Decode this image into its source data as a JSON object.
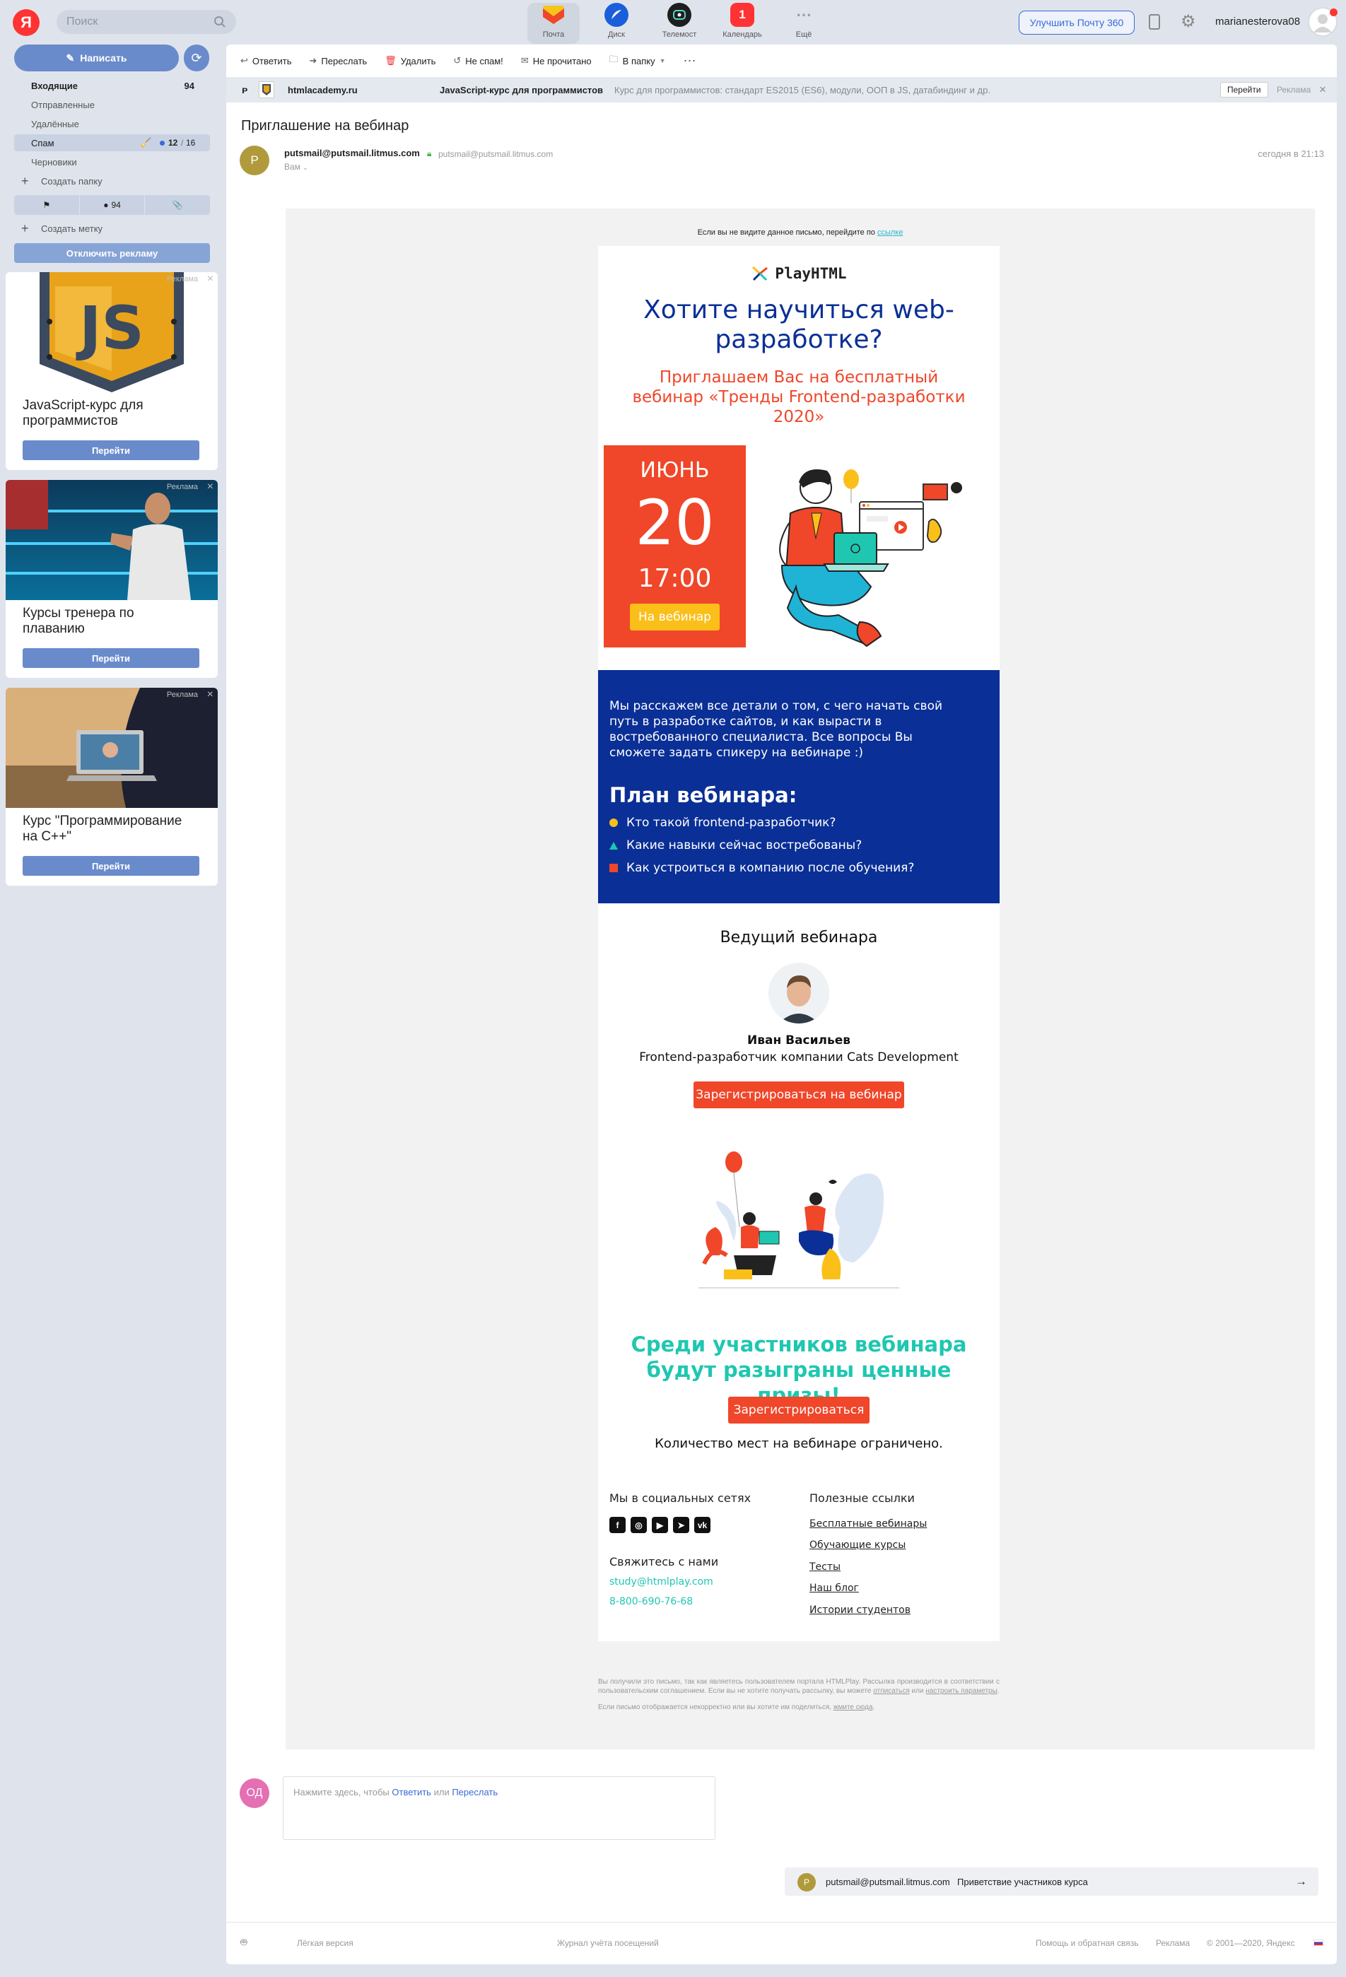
{
  "header": {
    "logo": "Я",
    "search_placeholder": "Поиск",
    "services": [
      {
        "label": "Почта",
        "icon": "mail-icon"
      },
      {
        "label": "Диск",
        "icon": "disk-icon"
      },
      {
        "label": "Телемост",
        "icon": "telemost-icon"
      },
      {
        "label": "Календарь",
        "icon": "calendar-icon",
        "badge": "1"
      },
      {
        "label": "Ещё",
        "icon": "more-icon"
      }
    ],
    "upgrade_button": "Улучшить Почту 360",
    "username": "marianesterova08"
  },
  "sidebar": {
    "compose": "Написать",
    "folders": [
      {
        "label": "Входящие",
        "count": "94"
      },
      {
        "label": "Отправленные",
        "count": ""
      },
      {
        "label": "Удалённые",
        "count": ""
      },
      {
        "label": "Спам",
        "count": "12",
        "total": "16"
      },
      {
        "label": "Черновики",
        "count": ""
      }
    ],
    "create_folder": "Создать папку",
    "tag_unread_count": "94",
    "create_label": "Создать метку",
    "disable_ads": "Отключить рекламу",
    "ad_label": "Реклама",
    "ads": [
      {
        "title": "JavaScript-курс для программистов",
        "button": "Перейти"
      },
      {
        "title": "Курсы тренера по плаванию",
        "button": "Перейти"
      },
      {
        "title": "Курс \"Программирование на С++\"",
        "button": "Перейти"
      }
    ]
  },
  "toolbar": {
    "reply": "Ответить",
    "forward": "Переслать",
    "delete": "Удалить",
    "not_spam": "Не спам!",
    "unread": "Не прочитано",
    "to_folder": "В папку"
  },
  "ad_strip": {
    "site": "htmlacademy.ru",
    "title": "JavaScript-курс для программистов",
    "text": "Курс для программистов: стандарт ES2015 (ES6), модули, ООП в JS, датабиндинг и др.",
    "button": "Перейти",
    "label": "Реклама"
  },
  "message": {
    "subject": "Приглашение на вебинар",
    "avatar_letter": "P",
    "from_name": "putsmail@putsmail.litmus.com",
    "from_address": "putsmail@putsmail.litmus.com",
    "to": "Вам",
    "date": "сегодня в 21:13"
  },
  "email": {
    "view_online_prefix": "Если вы не видите данное письмо, перейдите по",
    "view_online_link": "ссылке",
    "brand": "PlayHTML",
    "hero_title": "Хотите научиться web-разработке?",
    "hero_subtitle": "Приглашаем Вас на бесплатный вебинар «Тренды Frontend-разработки 2020»",
    "month": "ИЮНЬ",
    "day": "20",
    "time": "17:00",
    "webinar_button": "На вебинар",
    "intro": "Мы расскажем все детали о том, с чего начать свой путь в разработке сайтов, и как вырасти в востребованного специалиста. Все вопросы Вы сможете задать спикеру на вебинаре :)",
    "plan_title": "План вебинара:",
    "plan": [
      {
        "text": "Кто такой frontend-разработчик?",
        "marker": "circle",
        "color": "#fbbf1a"
      },
      {
        "text": "Какие навыки сейчас востребованы?",
        "marker": "triangle",
        "color": "#1fc7b1"
      },
      {
        "text": "Как устроиться в компанию после обучения?",
        "marker": "square",
        "color": "#f04629"
      }
    ],
    "host_title": "Ведущий вебинара",
    "host_name": "Иван Васильев",
    "host_role": "Frontend-разработчик компании Cats Development",
    "register_button": "Зарегистрироваться на вебинар",
    "prize_text": "Среди участников вебинара будут разыграны ценные призы!",
    "register_short": "Зарегистрироваться",
    "limited": "Количество мест на вебинаре ограничено.",
    "social_title": "Мы в социальных сетях",
    "contact_title": "Свяжитесь с нами",
    "email_contact": "study@htmlplay.com",
    "phone": "8-800-690-76-68",
    "useful_title": "Полезные ссылки",
    "useful_links": [
      "Бесплатные вебинары",
      "Обучающие курсы",
      "Тесты",
      "Наш блог",
      "Истории студентов"
    ],
    "legal_1": "Вы получили это письмо, так как являетесь пользователем портала HTMLPlay. Рассылка производится в соответствии с пользовательским соглашением. Если вы не хотите получать рассылку, вы можете",
    "legal_unsub": "отписаться",
    "legal_or": "или",
    "legal_settings": "настроить параметры",
    "legal_2": "Если письмо отображается некорректно или вы хотите им поделиться,",
    "legal_2_link": "жмите сюда"
  },
  "reply": {
    "avatar": "ОД",
    "prefix": "Нажмите здесь, чтобы",
    "reply_link": "Ответить",
    "or": "или",
    "forward_link": "Переслать"
  },
  "next_mail": {
    "avatar": "P",
    "from": "putsmail@putsmail.litmus.com",
    "subject": "Приветствие участников курса"
  },
  "footer": {
    "light_version": "Лёгкая версия",
    "journal": "Журнал учёта посещений",
    "help": "Помощь и обратная связь",
    "ads": "Реклама",
    "copyright": "© 2001—2020, Яндекс"
  },
  "colors": {
    "accent_blue": "#0a2f96",
    "accent_red": "#f04629",
    "accent_teal": "#1fc7b1",
    "accent_yellow": "#fbbf1a",
    "sidebar_button": "#6a8bcb"
  }
}
